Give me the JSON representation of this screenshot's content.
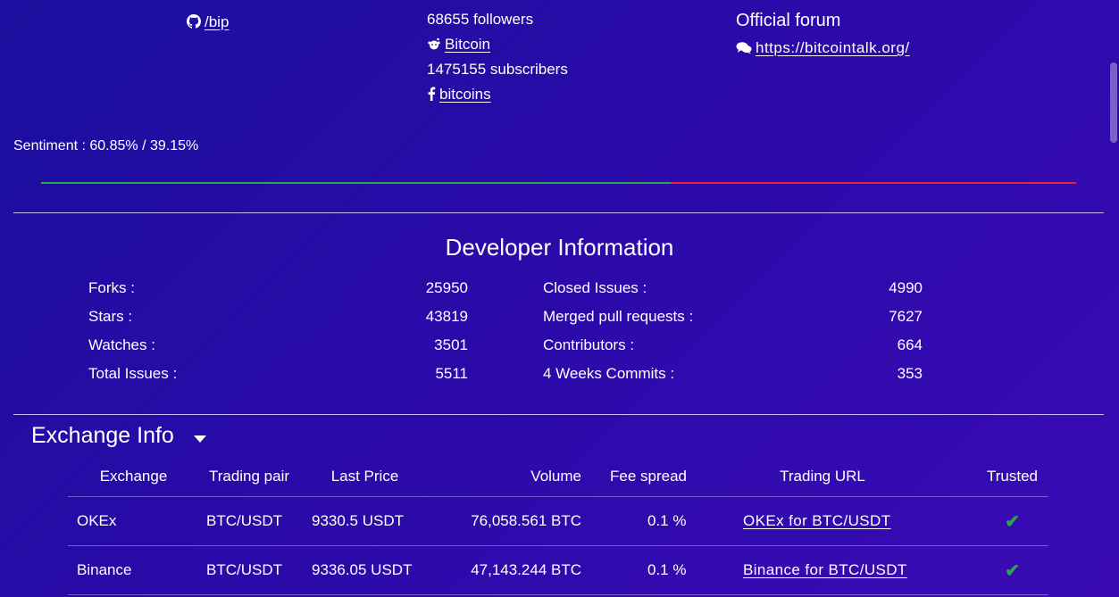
{
  "links_left": {
    "github_label": "/bip"
  },
  "links_mid": {
    "twitter_followers": "68655 followers",
    "reddit_label": "Bitcoin",
    "reddit_subscribers": "1475155 subscribers",
    "facebook_label": "bitcoins"
  },
  "links_right": {
    "forum_heading": "Official forum",
    "forum_url": "https://bitcointalk.org/"
  },
  "sentiment": {
    "text": "Sentiment : 60.85% / 39.15%",
    "positive_pct": 60.85,
    "negative_pct": 39.15,
    "positive_color": "#2da44e",
    "negative_color": "#e0243a"
  },
  "developer": {
    "title": "Developer Information",
    "left": [
      {
        "label": "Forks :",
        "value": "25950"
      },
      {
        "label": "Stars :",
        "value": "43819"
      },
      {
        "label": "Watches :",
        "value": "3501"
      },
      {
        "label": "Total Issues :",
        "value": "5511"
      }
    ],
    "right": [
      {
        "label": "Closed Issues :",
        "value": "4990"
      },
      {
        "label": "Merged pull requests :",
        "value": "7627"
      },
      {
        "label": "Contributors :",
        "value": "664"
      },
      {
        "label": "4 Weeks Commits :",
        "value": "353"
      }
    ]
  },
  "exchange": {
    "title": "Exchange Info",
    "columns": [
      "Exchange",
      "Trading pair",
      "Last Price",
      "Volume",
      "Fee spread",
      "Trading URL",
      "Trusted"
    ],
    "rows": [
      {
        "exchange": "OKEx",
        "pair": "BTC/USDT",
        "price": "9330.5 USDT",
        "volume": "76,058.561 BTC",
        "fee": "0.1 %",
        "url": "OKEx for BTC/USDT",
        "trusted": "✔"
      },
      {
        "exchange": "Binance",
        "pair": "BTC/USDT",
        "price": "9336.05 USDT",
        "volume": "47,143.244 BTC",
        "fee": "0.1 %",
        "url": "Binance for BTC/USDT",
        "trusted": "✔"
      }
    ]
  }
}
